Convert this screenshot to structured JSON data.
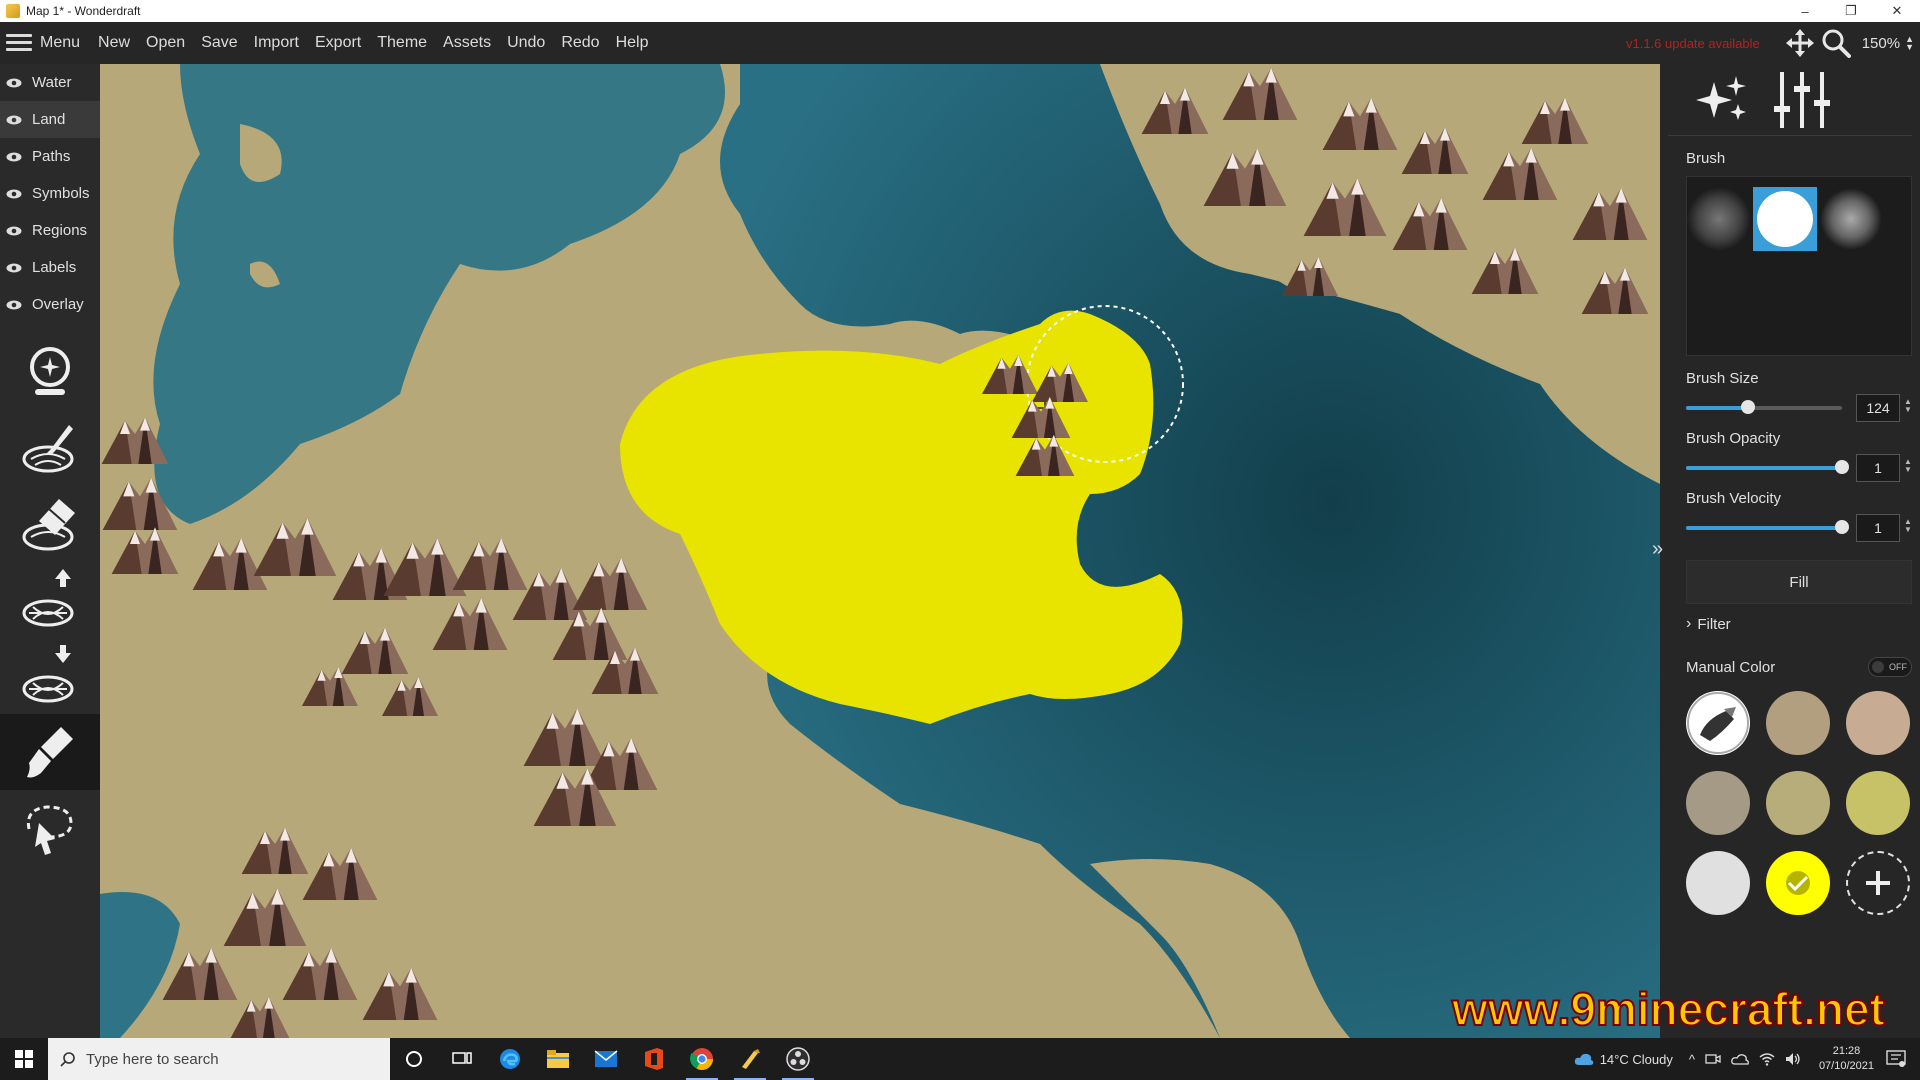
{
  "window": {
    "title": "Map 1* - Wonderdraft",
    "minimize": "–",
    "restore": "❐",
    "close": "✕"
  },
  "menubar": {
    "menu_label": "Menu",
    "items": [
      "New",
      "Open",
      "Save",
      "Import",
      "Export",
      "Theme",
      "Assets",
      "Undo",
      "Redo",
      "Help"
    ],
    "update_notice": "v1.1.6 update available",
    "zoom": "150%"
  },
  "layers": [
    {
      "label": "Water"
    },
    {
      "label": "Land"
    },
    {
      "label": "Paths"
    },
    {
      "label": "Symbols"
    },
    {
      "label": "Regions"
    },
    {
      "label": "Labels"
    },
    {
      "label": "Overlay"
    }
  ],
  "tools": [
    "landmass-generator",
    "land-brush",
    "eraser",
    "raise-land",
    "lower-land",
    "color-brush",
    "lasso-select"
  ],
  "right_panel": {
    "brush_label": "Brush",
    "brush_size_label": "Brush Size",
    "brush_size": "124",
    "brush_size_level": 0.4,
    "brush_opacity_label": "Brush Opacity",
    "brush_opacity": "1",
    "brush_opacity_level": 1,
    "brush_velocity_label": "Brush Velocity",
    "brush_velocity": "1",
    "brush_velocity_level": 1,
    "fill_label": "Fill",
    "filter_label": "Filter",
    "manual_color_label": "Manual Color",
    "manual_color_toggle": "OFF",
    "swatches": [
      "#b19f80",
      "#c7ac93",
      "#a49a85",
      "#b6ad7a",
      "#c7c168",
      "#e0e0e0",
      "#ffff00"
    ],
    "accent": "#3a9fd8"
  },
  "watermark": "www.9minecraft.net",
  "taskbar": {
    "search_placeholder": "Type here to search",
    "weather": "14°C  Cloudy",
    "time": "21:28",
    "date": "07/10/2021"
  }
}
